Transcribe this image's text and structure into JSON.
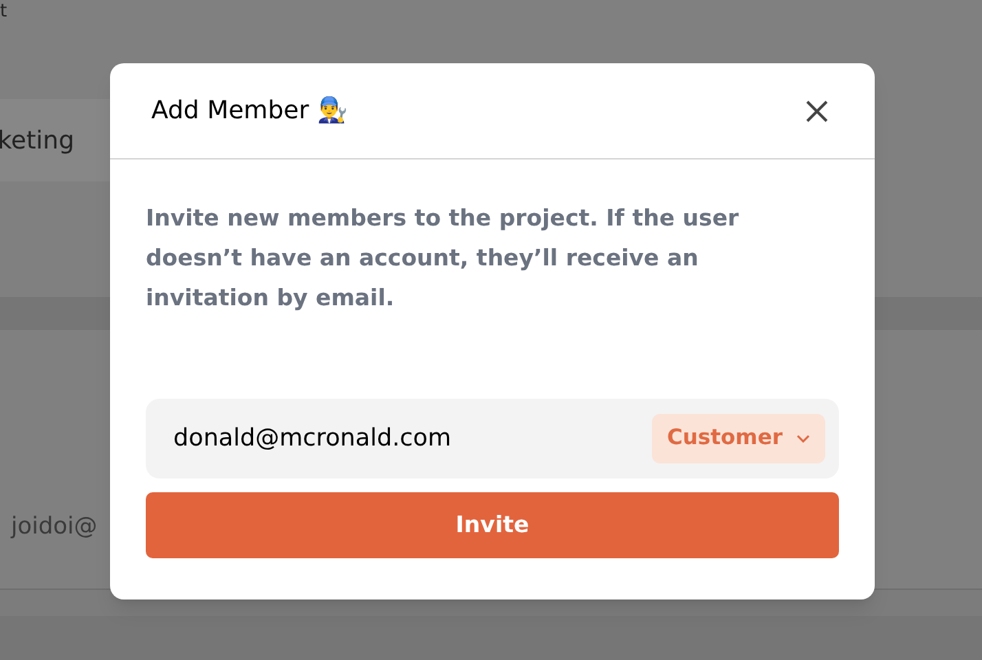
{
  "background": {
    "top_text": "t",
    "section_label": "keting",
    "member_email": "joidoi@"
  },
  "dialog": {
    "title": "Add Member 👨‍🔧",
    "description": "Invite new members to the project. If the user doesn’t have an account, they’ll receive an invitation by email.",
    "email": {
      "value": "donald@mcronald.com"
    },
    "role": "Customer",
    "button": "Invite"
  }
}
